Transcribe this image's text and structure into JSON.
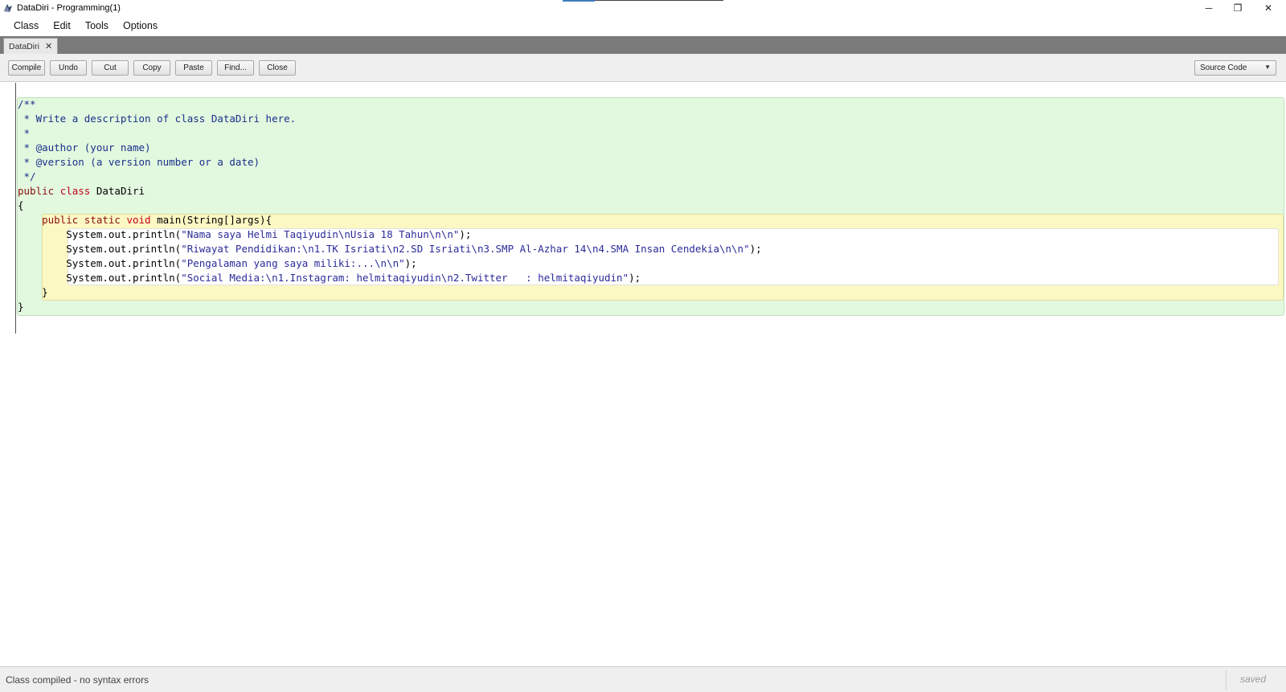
{
  "window": {
    "title": "DataDiri - Programming(1)",
    "controls": {
      "minimize": "─",
      "restore": "❐",
      "close": "✕"
    }
  },
  "menu": {
    "items": [
      "Class",
      "Edit",
      "Tools",
      "Options"
    ]
  },
  "tabs": [
    {
      "label": "DataDiri",
      "close": "✕"
    }
  ],
  "toolbar": {
    "buttons": [
      "Compile",
      "Undo",
      "Cut",
      "Copy",
      "Paste",
      "Find...",
      "Close"
    ],
    "view_select": "Source Code"
  },
  "editor": {
    "lines": [
      [
        {
          "t": "/**",
          "c": "comment"
        }
      ],
      [
        {
          "t": " * Write a description of class DataDiri here.",
          "c": "comment"
        }
      ],
      [
        {
          "t": " *",
          "c": "comment"
        }
      ],
      [
        {
          "t": " * @author (your name)",
          "c": "comment"
        }
      ],
      [
        {
          "t": " * @version (a version number or a date)",
          "c": "comment"
        }
      ],
      [
        {
          "t": " */",
          "c": "comment"
        }
      ],
      [
        {
          "t": "public ",
          "c": "kw"
        },
        {
          "t": "class ",
          "c": "kw2"
        },
        {
          "t": "DataDiri",
          "c": ""
        }
      ],
      [
        {
          "t": "{",
          "c": ""
        }
      ],
      [
        {
          "t": "    ",
          "c": ""
        },
        {
          "t": "public ",
          "c": "kw"
        },
        {
          "t": "static ",
          "c": "kw"
        },
        {
          "t": "void ",
          "c": "kw2"
        },
        {
          "t": "main(String[]args){",
          "c": ""
        }
      ],
      [
        {
          "t": "        System.out.println(",
          "c": ""
        },
        {
          "t": "\"Nama saya Helmi Taqiyudin\\nUsia 18 Tahun\\n\\n\"",
          "c": "str"
        },
        {
          "t": ");",
          "c": ""
        }
      ],
      [
        {
          "t": "        System.out.println(",
          "c": ""
        },
        {
          "t": "\"Riwayat Pendidikan:\\n1.TK Isriati\\n2.SD Isriati\\n3.SMP Al-Azhar 14\\n4.SMA Insan Cendekia\\n\\n\"",
          "c": "str"
        },
        {
          "t": ");",
          "c": ""
        }
      ],
      [
        {
          "t": "        System.out.println(",
          "c": ""
        },
        {
          "t": "\"Pengalaman yang saya miliki:...\\n\\n\"",
          "c": "str"
        },
        {
          "t": ");",
          "c": ""
        }
      ],
      [
        {
          "t": "        System.out.println(",
          "c": ""
        },
        {
          "t": "\"Social Media:\\n1.Instagram: helmitaqiyudin\\n2.Twitter   : helmitaqiyudin\"",
          "c": "str"
        },
        {
          "t": ");",
          "c": ""
        }
      ],
      [
        {
          "t": "    }",
          "c": ""
        }
      ],
      [
        {
          "t": "}",
          "c": ""
        }
      ]
    ]
  },
  "status": {
    "message": "Class compiled - no syntax errors",
    "saved": "saved"
  }
}
